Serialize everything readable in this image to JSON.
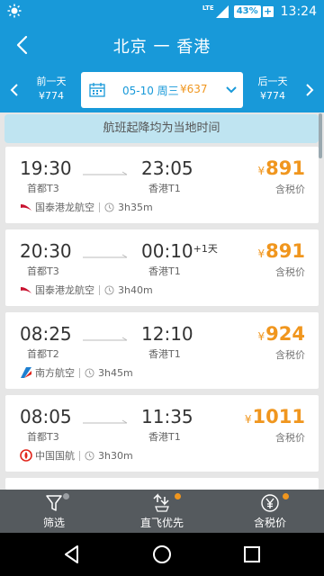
{
  "status_bar": {
    "network": "LTE",
    "battery": "43%",
    "time": "13:24"
  },
  "header": {
    "title": "北京 一 香港"
  },
  "date_bar": {
    "prev_label": "前一天",
    "prev_price": "¥774",
    "current_date": "05-10 周三",
    "current_price": "¥637",
    "next_label": "后一天",
    "next_price": "¥774"
  },
  "notice": "航班起降均为当地时间",
  "flights": [
    {
      "dep_time": "19:30",
      "dep_airport": "首都T3",
      "arr_time": "23:05",
      "plus_day": "",
      "arr_airport": "香港T1",
      "price_symbol": "¥",
      "price": "891",
      "tax_label": "含税价",
      "airline": "国泰港龙航空",
      "duration": "3h35m",
      "logo": "cathay-logo"
    },
    {
      "dep_time": "20:30",
      "dep_airport": "首都T3",
      "arr_time": "00:10",
      "plus_day": "+1天",
      "arr_airport": "香港T1",
      "price_symbol": "¥",
      "price": "891",
      "tax_label": "含税价",
      "airline": "国泰港龙航空",
      "duration": "3h40m",
      "logo": "cathay-logo"
    },
    {
      "dep_time": "08:25",
      "dep_airport": "首都T2",
      "arr_time": "12:10",
      "plus_day": "",
      "arr_airport": "香港T1",
      "price_symbol": "¥",
      "price": "924",
      "tax_label": "含税价",
      "airline": "南方航空",
      "duration": "3h45m",
      "logo": "china-southern-logo"
    },
    {
      "dep_time": "08:05",
      "dep_airport": "首都T3",
      "arr_time": "11:35",
      "plus_day": "",
      "arr_airport": "香港T1",
      "price_symbol": "¥",
      "price": "1011",
      "tax_label": "含税价",
      "airline": "中国国航",
      "duration": "3h30m",
      "logo": "air-china-logo"
    }
  ],
  "toolbar": {
    "filter_label": "筛选",
    "direct_label": "直飞优先",
    "price_label": "含税价"
  },
  "colors": {
    "primary": "#1899d9",
    "price": "#f0961e",
    "toolbar": "#555a5e",
    "dot_inactive": "#9a9ea2",
    "dot_active": "#f0961e"
  }
}
